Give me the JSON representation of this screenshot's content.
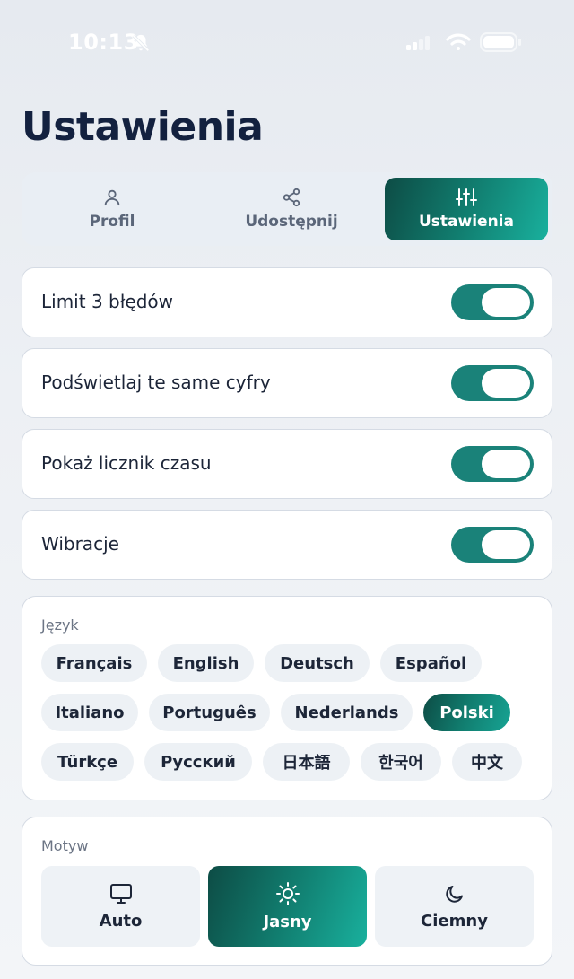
{
  "status_bar": {
    "time": "10:13",
    "icons": [
      "bell-slash-icon",
      "signal-icon",
      "wifi-icon",
      "battery-icon"
    ]
  },
  "page": {
    "title": "Ustawienia"
  },
  "tabs": [
    {
      "label": "Profil",
      "icon": "user-icon",
      "active": false
    },
    {
      "label": "Udostępnij",
      "icon": "share-icon",
      "active": false
    },
    {
      "label": "Ustawienia",
      "icon": "sliders-icon",
      "active": true
    }
  ],
  "toggles": [
    {
      "label": "Limit 3 błędów",
      "on": true
    },
    {
      "label": "Podświetlaj te same cyfry",
      "on": true
    },
    {
      "label": "Pokaż licznik czasu",
      "on": true
    },
    {
      "label": "Wibracje",
      "on": true
    }
  ],
  "language": {
    "label": "Język",
    "options": [
      "Français",
      "English",
      "Deutsch",
      "Español",
      "Italiano",
      "Português",
      "Nederlands",
      "Polski",
      "Türkçe",
      "Русский",
      "日本語",
      "한국어",
      "中文"
    ],
    "selected": "Polski"
  },
  "theme": {
    "label": "Motyw",
    "options": [
      {
        "label": "Auto",
        "icon": "monitor-icon"
      },
      {
        "label": "Jasny",
        "icon": "sun-icon"
      },
      {
        "label": "Ciemny",
        "icon": "moon-icon"
      }
    ],
    "selected": "Jasny"
  },
  "colors": {
    "accent": "#117d6f",
    "toggle_on": "#1a8279",
    "title": "#13213f"
  }
}
